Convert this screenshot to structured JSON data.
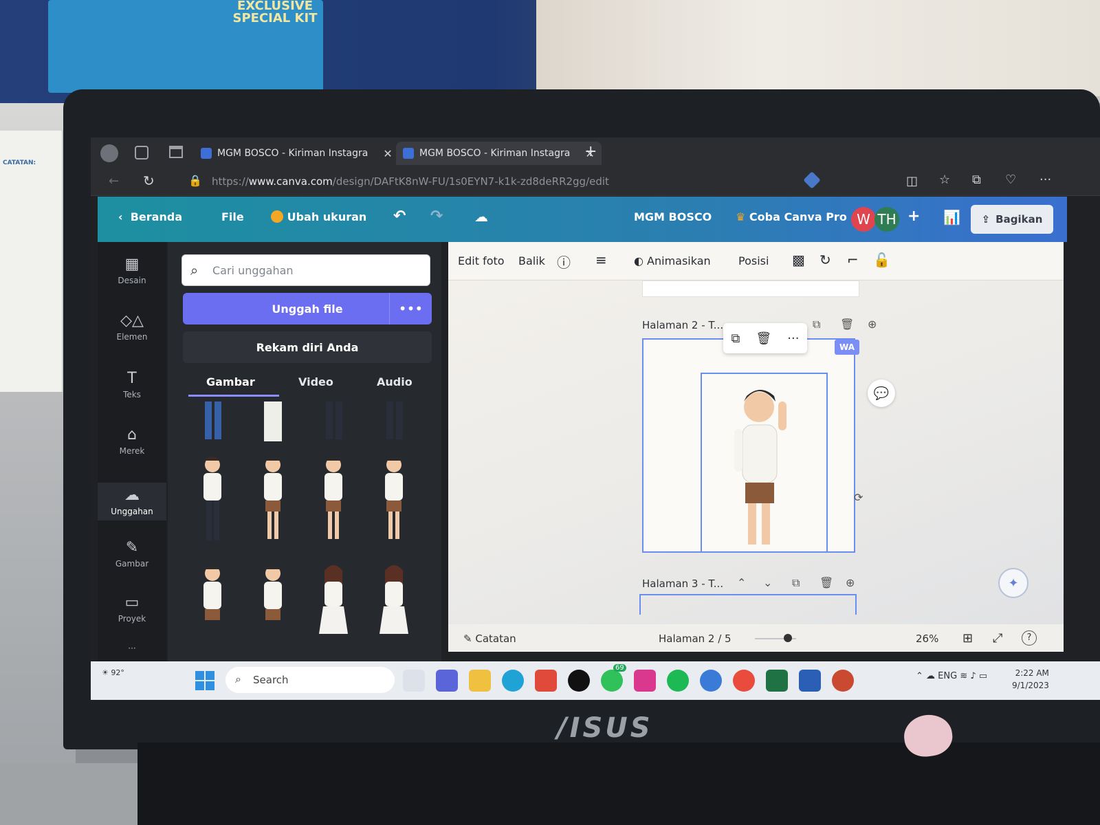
{
  "room": {
    "box_text": "EXCLUSIVE SPECIAL KIT",
    "notebook_label": "CATATAN:",
    "laptop_brand": "/ISUS"
  },
  "browser": {
    "tabs": [
      {
        "title": "MGM BOSCO - Kiriman Instagra"
      },
      {
        "title": "MGM BOSCO - Kiriman Instagra"
      }
    ],
    "new_tab": "+",
    "url_prefix": "https://",
    "url_domain": "www.canva.com",
    "url_path": "/design/DAFtK8nW-FU/1s0EYN7-k1k-zd8deRR2gg/edit"
  },
  "canva_header": {
    "back_label": "Beranda",
    "file_label": "File",
    "resize_label": "Ubah ukuran",
    "project_title": "MGM BOSCO",
    "pro_label": "Coba Canva Pro",
    "avatar_w": "W",
    "avatar_th": "TH",
    "add_member": "+",
    "share_label": "Bagikan"
  },
  "rail": {
    "items": [
      {
        "label": "Desain"
      },
      {
        "label": "Elemen"
      },
      {
        "label": "Teks"
      },
      {
        "label": "Merek"
      },
      {
        "label": "Unggahan"
      },
      {
        "label": "Gambar"
      },
      {
        "label": "Proyek"
      }
    ],
    "more": "···"
  },
  "panel": {
    "search_placeholder": "Cari unggahan",
    "upload_label": "Unggah file",
    "upload_more": "•••",
    "record_label": "Rekam diri Anda",
    "tabs": [
      "Gambar",
      "Video",
      "Audio"
    ]
  },
  "canvas": {
    "toolbar": {
      "edit_photo": "Edit foto",
      "flip": "Balik",
      "animate": "Animasikan",
      "position": "Posisi"
    },
    "page2_label": "Halaman 2 - T...",
    "wa_badge": "WA",
    "page3_label": "Halaman 3 - T...",
    "footer": {
      "notes": "Catatan",
      "page_indicator": "Halaman 2 / 5",
      "zoom": "26%",
      "help": "?"
    }
  },
  "taskbar": {
    "weather": "92°",
    "search_placeholder": "Search",
    "whatsapp_badge": "69",
    "language": "ENG",
    "time": "2:22 AM",
    "date": "9/1/2023"
  },
  "colors": {
    "canva_header_start": "#1d8fa0",
    "canva_header_end": "#3a6fcf",
    "upload_button": "#6b6ef0",
    "selection": "#6a8ef0",
    "avatar_w": "#e0454f",
    "avatar_th": "#2f7d52"
  }
}
